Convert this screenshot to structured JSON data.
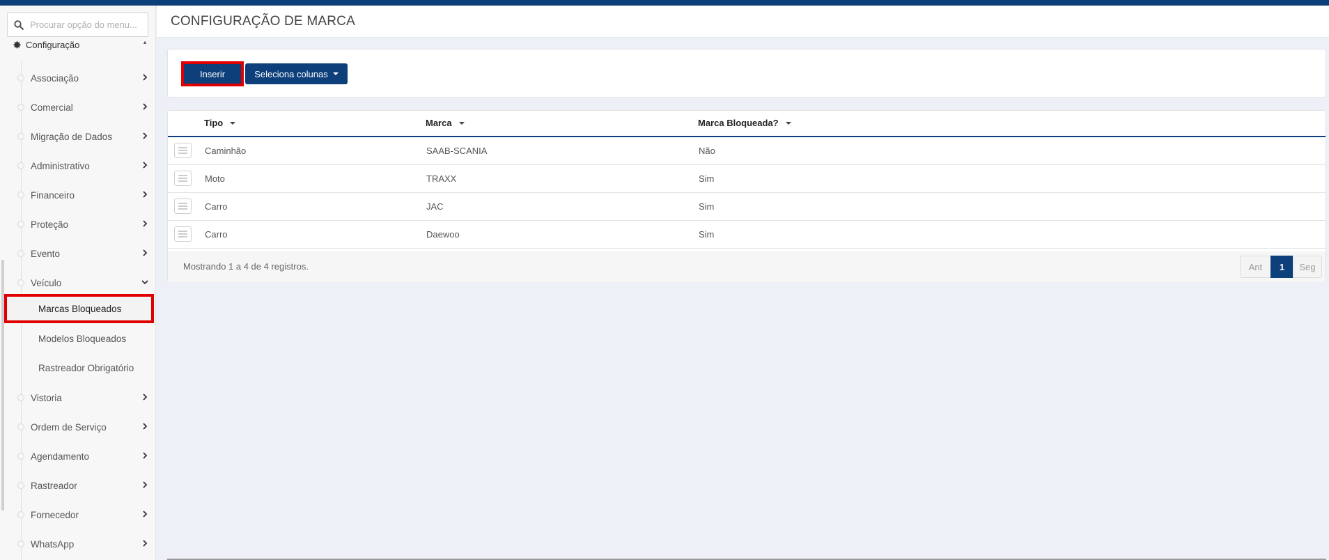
{
  "sidebar": {
    "search_placeholder": "Procurar opção do menu...",
    "section_label": "Configuração",
    "items": [
      {
        "label": "Associação"
      },
      {
        "label": "Comercial"
      },
      {
        "label": "Migração de Dados"
      },
      {
        "label": "Administrativo"
      },
      {
        "label": "Financeiro"
      },
      {
        "label": "Proteção"
      },
      {
        "label": "Evento"
      },
      {
        "label": "Veículo",
        "expanded": true
      },
      {
        "label": "Vistoria"
      },
      {
        "label": "Ordem de Serviço"
      },
      {
        "label": "Agendamento"
      },
      {
        "label": "Rastreador"
      },
      {
        "label": "Fornecedor"
      },
      {
        "label": "WhatsApp"
      }
    ],
    "sub_items": [
      {
        "label": "Marcas Bloqueados",
        "active": true
      },
      {
        "label": "Modelos Bloqueados"
      },
      {
        "label": "Rastreador Obrigatório"
      }
    ]
  },
  "page": {
    "title": "CONFIGURAÇÃO DE MARCA"
  },
  "toolbar": {
    "insert_label": "Inserir",
    "columns_label": "Seleciona colunas"
  },
  "table": {
    "headers": [
      "Tipo",
      "Marca",
      "Marca Bloqueada?"
    ],
    "rows": [
      [
        "Caminhão",
        "SAAB-SCANIA",
        "Não"
      ],
      [
        "Moto",
        "TRAXX",
        "Sim"
      ],
      [
        "Carro",
        "JAC",
        "Sim"
      ],
      [
        "Carro",
        "Daewoo",
        "Sim"
      ]
    ],
    "footer_info": "Mostrando 1 a 4 de 4 registros.",
    "pagination": {
      "prev": "Ant",
      "current": "1",
      "next": "Seg"
    }
  },
  "colors": {
    "primary": "#0d3f7a",
    "highlight": "#e10000"
  }
}
